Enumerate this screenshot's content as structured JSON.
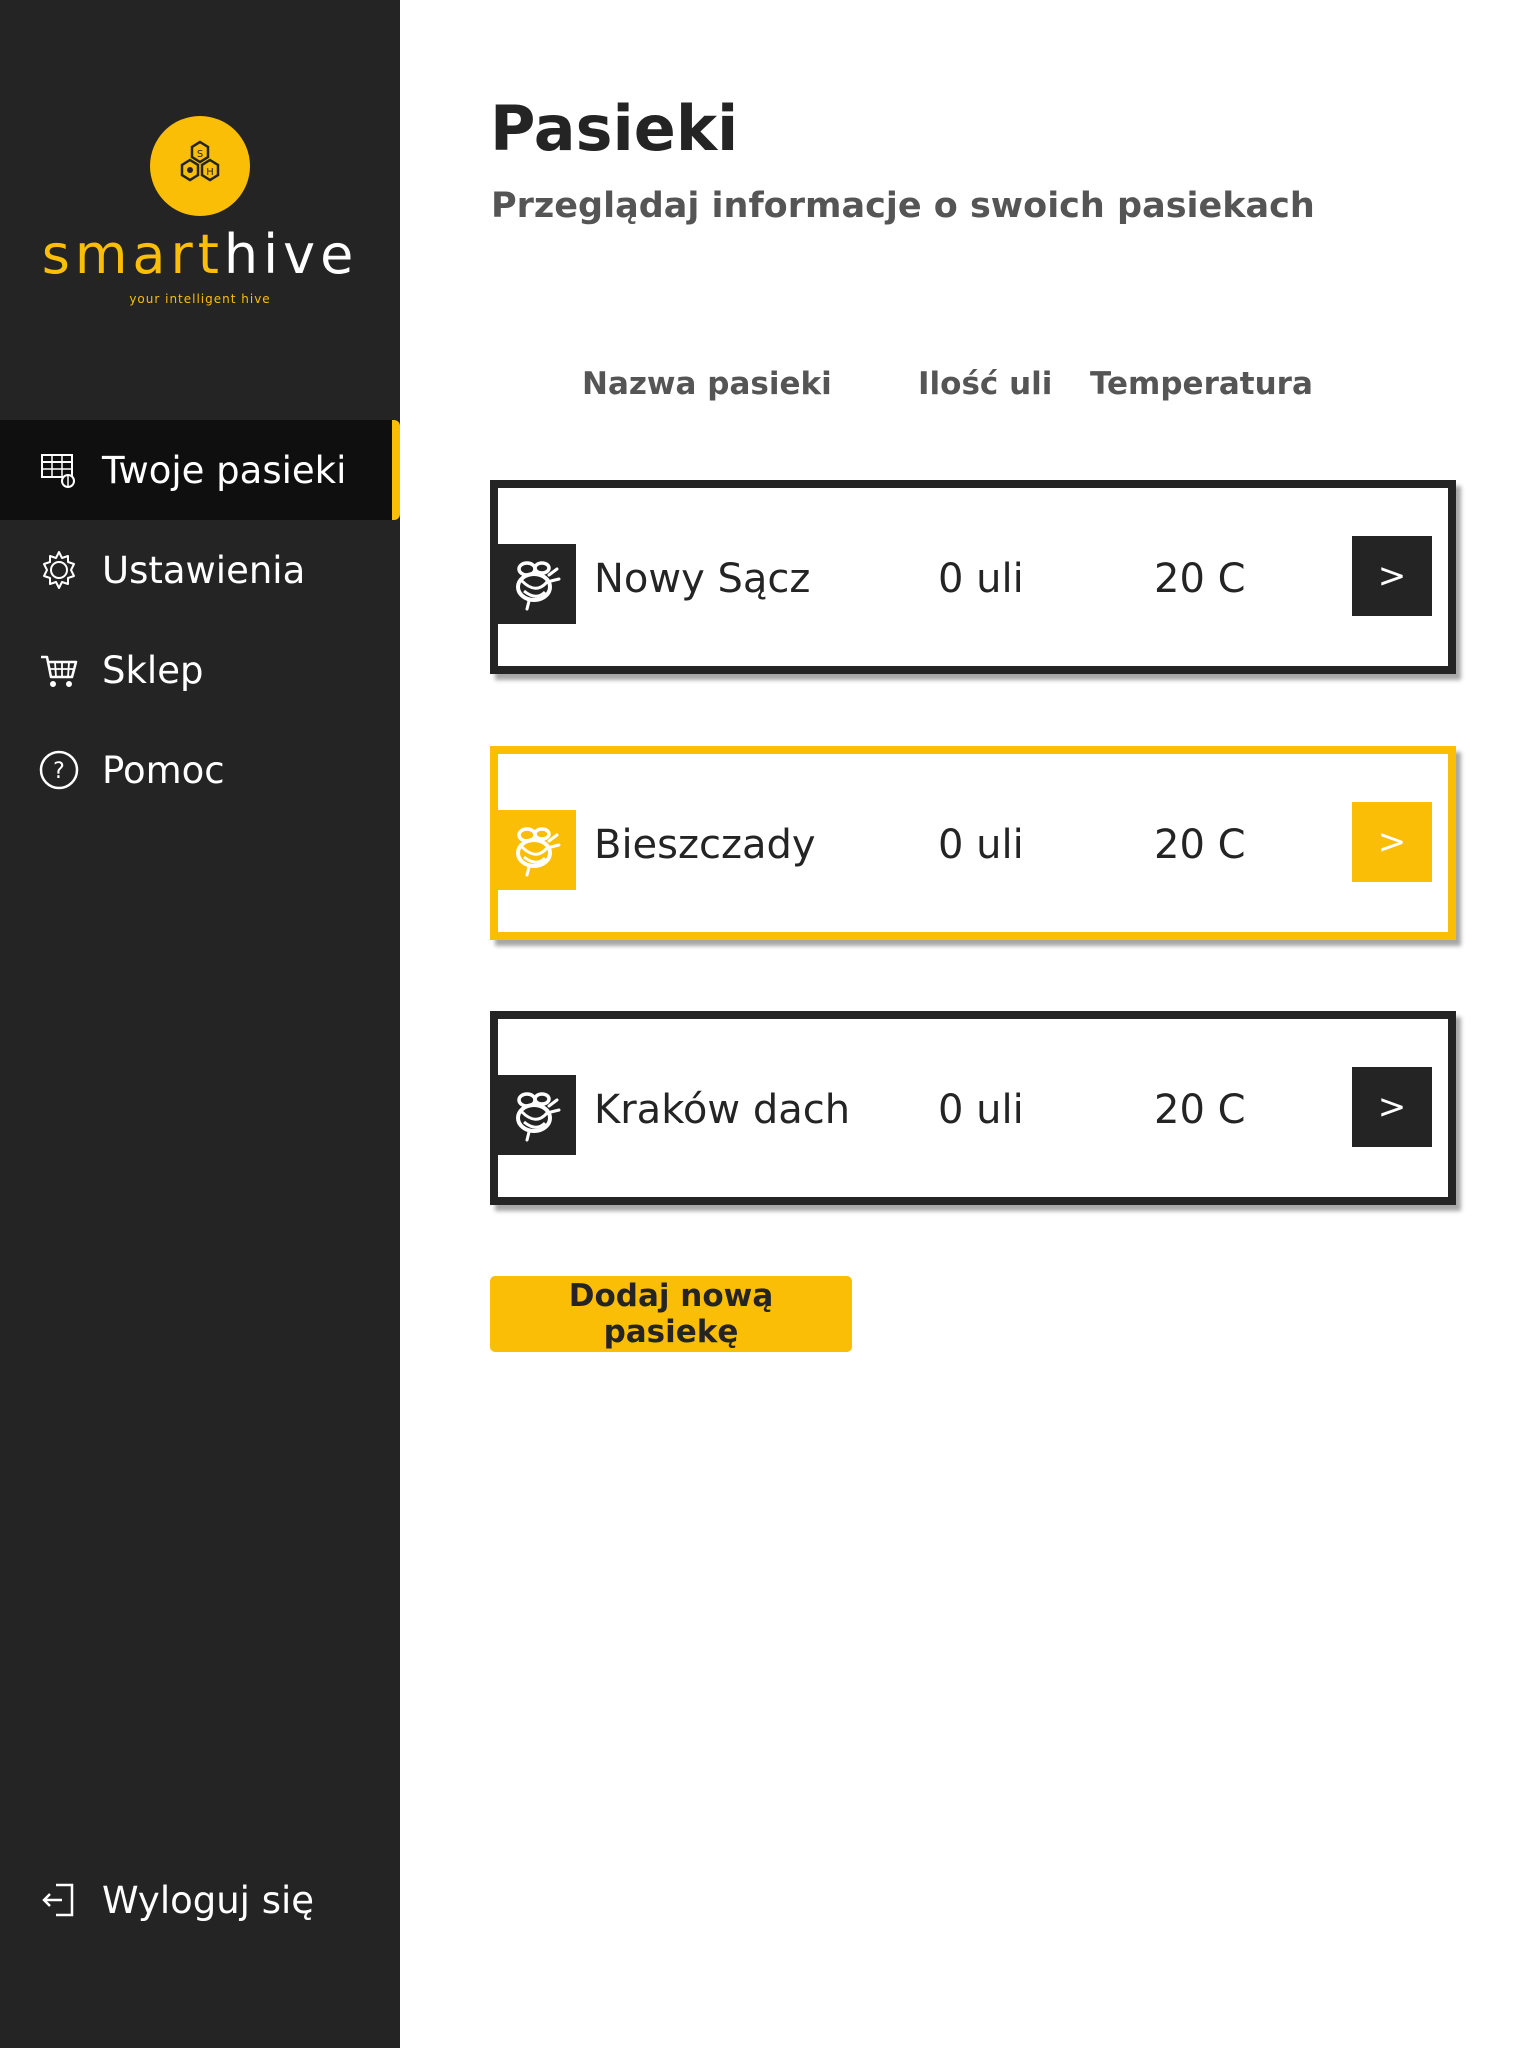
{
  "brand": {
    "name_part1": "smart",
    "name_part2": "hive",
    "tagline": "your intelligent hive",
    "accent_color": "#fbbe06",
    "sidebar_color": "#242424"
  },
  "sidebar": {
    "items": [
      {
        "label": "Twoje pasieki",
        "icon": "hive-frame-icon",
        "active": true
      },
      {
        "label": "Ustawienia",
        "icon": "gear-icon",
        "active": false
      },
      {
        "label": "Sklep",
        "icon": "cart-icon",
        "active": false
      },
      {
        "label": "Pomoc",
        "icon": "help-circle-icon",
        "active": false
      }
    ],
    "logout_label": "Wyloguj się"
  },
  "header": {
    "title": "Pasieki",
    "subtitle": "Przeglądaj informacje o swoich pasiekach"
  },
  "table": {
    "columns": [
      "Nazwa pasieki",
      "Ilość uli",
      "Temperatura"
    ],
    "rows": [
      {
        "name": "Nowy Sącz",
        "hives": "0 uli",
        "temperature": "20 C",
        "action": ">",
        "highlighted": false
      },
      {
        "name": "Bieszczady",
        "hives": "0 uli",
        "temperature": "20 C",
        "action": ">",
        "highlighted": true
      },
      {
        "name": "Kraków dach",
        "hives": "0 uli",
        "temperature": "20 C",
        "action": ">",
        "highlighted": false
      }
    ]
  },
  "actions": {
    "add_label": "Dodaj nową pasiekę"
  }
}
